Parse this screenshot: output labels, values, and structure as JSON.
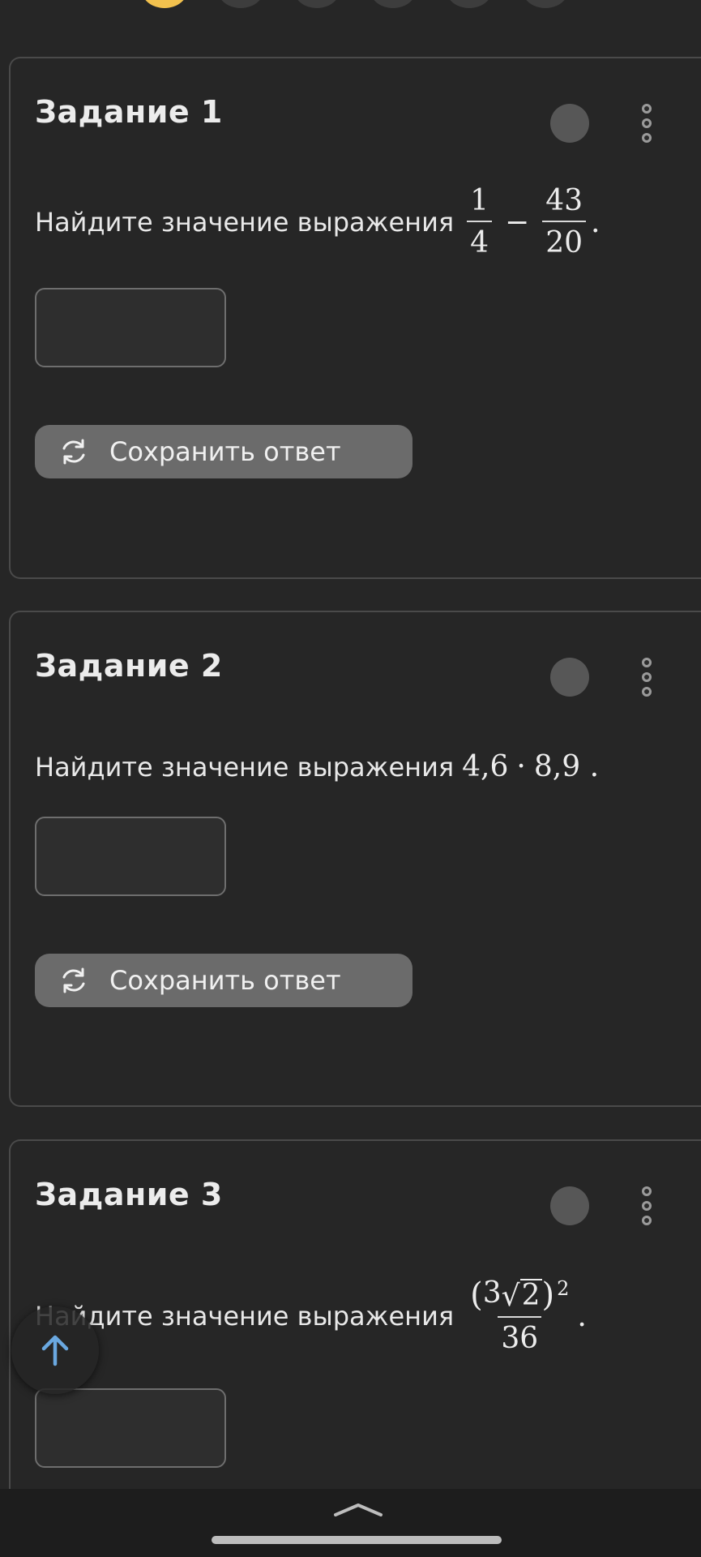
{
  "tasks": [
    {
      "title": "Задание 1",
      "question_prefix": "Найдите значение выражения",
      "expr": {
        "numerator_a": "1",
        "denominator_a": "4",
        "operator": "−",
        "numerator_b": "43",
        "denominator_b": "20",
        "suffix": "."
      },
      "answer_value": "",
      "save_label": "Сохранить ответ"
    },
    {
      "title": "Задание 2",
      "question_prefix": "Найдите значение выражения",
      "expr": {
        "a": "4,6",
        "operator": "·",
        "b": "8,9",
        "suffix": "."
      },
      "answer_value": "",
      "save_label": "Сохранить ответ"
    },
    {
      "title": "Задание 3",
      "question_prefix": "Найдите значение выражения",
      "expr": {
        "coef": "3",
        "radicand": "2",
        "exponent": "2",
        "denominator": "36",
        "suffix": "."
      },
      "answer_value": ""
    }
  ],
  "icons": {
    "menu": "kebab-menu-icon",
    "save": "refresh-icon",
    "scroll_top": "arrow-up-icon",
    "bottom": "chevron-up-icon"
  },
  "colors": {
    "background": "#262626",
    "accent_dot": "#f2c14e",
    "button": "#6b6b6b",
    "arrow": "#6aa8e0"
  }
}
